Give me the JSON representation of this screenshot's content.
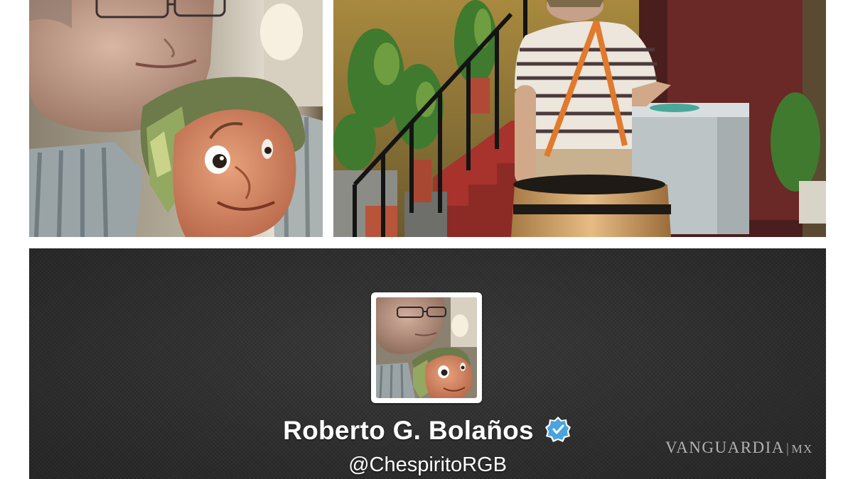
{
  "photos": {
    "left": {
      "icon": "man-with-puppet-photo"
    },
    "right": {
      "icon": "man-in-barrel-photo"
    }
  },
  "profile": {
    "name": "Roberto G. Bolaños",
    "handle": "@ChespiritoRGB",
    "verified": true,
    "avatar_icon": "profile-avatar-image",
    "badge_icon": "verified-check-icon",
    "colors": {
      "header_bg": "#2e2e2e",
      "badge_blue": "#4aa3df",
      "text": "#ffffff"
    }
  },
  "watermark": {
    "text": "VANGUARDIA",
    "suffix": "MX"
  }
}
